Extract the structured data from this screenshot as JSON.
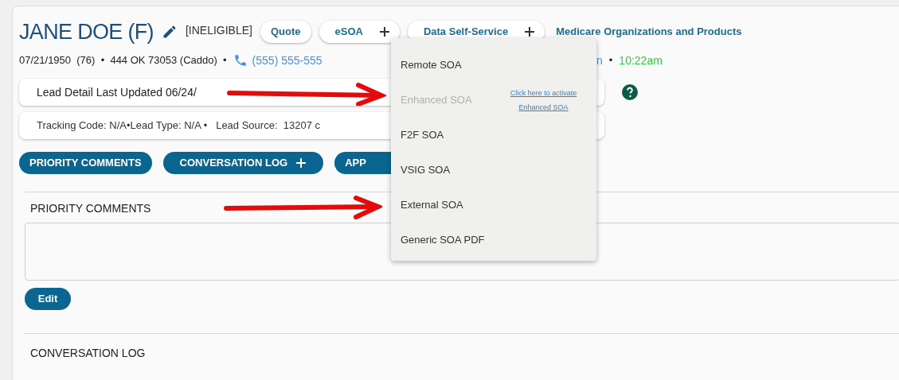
{
  "header": {
    "name": "JANE DOE (F)",
    "status": "[INELIGIBLE]",
    "actions": [
      {
        "label": "Quote",
        "kind": "button"
      },
      {
        "label": "eSOA",
        "kind": "menu"
      },
      {
        "label": "Data Self-Service",
        "kind": "menu"
      },
      {
        "label": "Medicare Organizations and Products",
        "kind": "link"
      }
    ]
  },
  "details": {
    "summary": "07/21/1950  (76)  •  444 OK 73053 (Caddo)  •",
    "phone": "(555) 555-555",
    "column_3": "n",
    "separator": "•",
    "local_time": "10:22am"
  },
  "info_cards": [
    "Lead Detail Last Updated 06/24/",
    "Tracking Code: N/A•Lead Type: N/A •   Lead Source:  13207 c"
  ],
  "section_buttons": [
    {
      "label": "PRIORITY COMMENTS",
      "plus": false
    },
    {
      "label": "CONVERSATION LOG",
      "plus": true
    },
    {
      "label": "APP",
      "plus": false
    }
  ],
  "priority_comments": {
    "title": "PRIORITY COMMENTS",
    "edit_button": "Edit"
  },
  "conversation_log": {
    "title": "CONVERSATION LOG"
  },
  "esoa_menu": {
    "items": [
      {
        "label": "Remote SOA",
        "disabled": false
      },
      {
        "label": "Enhanced SOA",
        "disabled": true,
        "link": "Click here to activate Enhanced SOA"
      },
      {
        "label": "F2F SOA",
        "disabled": false
      },
      {
        "label": "VSIG SOA",
        "disabled": false
      },
      {
        "label": "External SOA",
        "disabled": false
      },
      {
        "label": "Generic SOA PDF",
        "disabled": false
      }
    ]
  }
}
